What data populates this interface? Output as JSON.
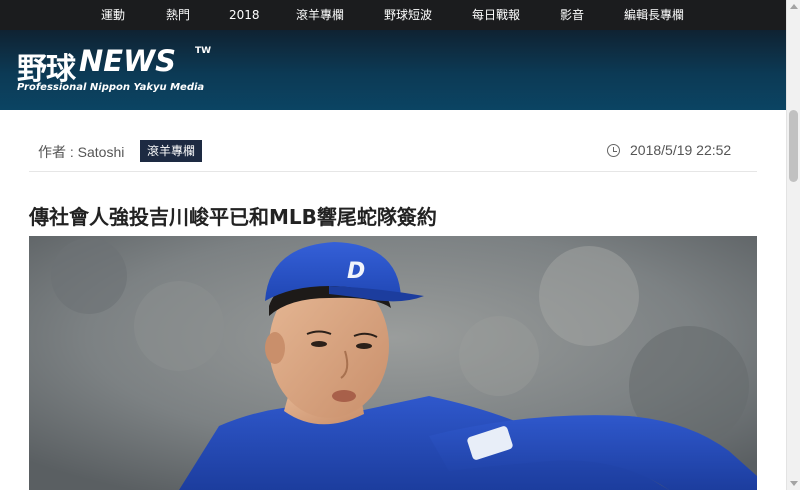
{
  "nav": {
    "items": [
      {
        "label": "運動"
      },
      {
        "label": "熱門"
      },
      {
        "label": "2018"
      },
      {
        "label": "滾羊專欄"
      },
      {
        "label": "野球短波"
      },
      {
        "label": "每日戰報"
      },
      {
        "label": "影音"
      },
      {
        "label": "編輯長專欄"
      }
    ]
  },
  "logo": {
    "title_jp": "野球",
    "title_news": "NEWS",
    "badge": "TW",
    "subtitle": "Professional Nippon Yakyu Media"
  },
  "article": {
    "author": "作者 : Satoshi",
    "category": "滾羊專欄",
    "datetime": "2018/5/19 22:52",
    "title": "傳社會人強投吉川峻平已和MLB響尾蛇隊簽約"
  },
  "colors": {
    "nav_bg": "#1b1c1e",
    "banner_bg": "#0c3a55",
    "badge_bg": "#1d2a42",
    "jersey_blue": "#2a4fc0"
  },
  "icons": {
    "time": "clock-icon"
  }
}
